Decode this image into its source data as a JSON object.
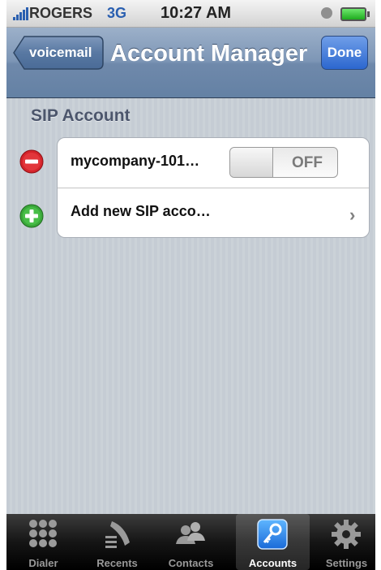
{
  "status_bar": {
    "carrier": "ROGERS",
    "network": "3G",
    "time": "10:27 AM"
  },
  "nav": {
    "back_label": "voicemail",
    "title": "Account Manager",
    "done_label": "Done"
  },
  "section": {
    "title": "SIP Account"
  },
  "accounts": {
    "row1_label": "mycompany-101…",
    "toggle_state": "OFF",
    "row2_label": "Add new SIP acco…"
  },
  "tabs": [
    {
      "label": "Dialer",
      "icon": "keypad-icon"
    },
    {
      "label": "Recents",
      "icon": "recents-icon"
    },
    {
      "label": "Contacts",
      "icon": "contacts-icon"
    },
    {
      "label": "Accounts",
      "icon": "key-icon",
      "active": true
    },
    {
      "label": "Settings",
      "icon": "gear-icon"
    }
  ],
  "colors": {
    "nav_bar": "#7d96b6",
    "done_button": "#2c67cf",
    "delete_red": "#d4242b",
    "add_green": "#3aa83a"
  }
}
